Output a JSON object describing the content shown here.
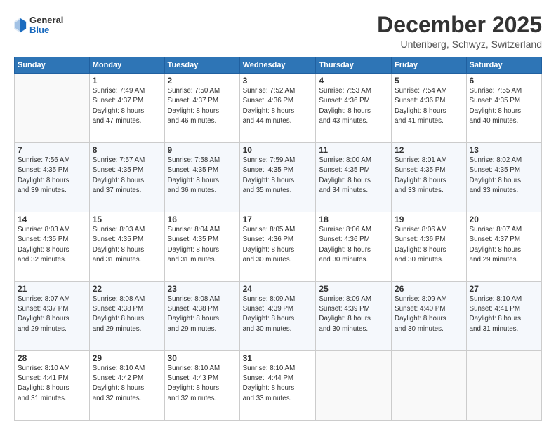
{
  "logo": {
    "general": "General",
    "blue": "Blue"
  },
  "header": {
    "month": "December 2025",
    "location": "Unteriberg, Schwyz, Switzerland"
  },
  "weekdays": [
    "Sunday",
    "Monday",
    "Tuesday",
    "Wednesday",
    "Thursday",
    "Friday",
    "Saturday"
  ],
  "weeks": [
    [
      {
        "day": "",
        "info": ""
      },
      {
        "day": "1",
        "info": "Sunrise: 7:49 AM\nSunset: 4:37 PM\nDaylight: 8 hours\nand 47 minutes."
      },
      {
        "day": "2",
        "info": "Sunrise: 7:50 AM\nSunset: 4:37 PM\nDaylight: 8 hours\nand 46 minutes."
      },
      {
        "day": "3",
        "info": "Sunrise: 7:52 AM\nSunset: 4:36 PM\nDaylight: 8 hours\nand 44 minutes."
      },
      {
        "day": "4",
        "info": "Sunrise: 7:53 AM\nSunset: 4:36 PM\nDaylight: 8 hours\nand 43 minutes."
      },
      {
        "day": "5",
        "info": "Sunrise: 7:54 AM\nSunset: 4:36 PM\nDaylight: 8 hours\nand 41 minutes."
      },
      {
        "day": "6",
        "info": "Sunrise: 7:55 AM\nSunset: 4:35 PM\nDaylight: 8 hours\nand 40 minutes."
      }
    ],
    [
      {
        "day": "7",
        "info": "Sunrise: 7:56 AM\nSunset: 4:35 PM\nDaylight: 8 hours\nand 39 minutes."
      },
      {
        "day": "8",
        "info": "Sunrise: 7:57 AM\nSunset: 4:35 PM\nDaylight: 8 hours\nand 37 minutes."
      },
      {
        "day": "9",
        "info": "Sunrise: 7:58 AM\nSunset: 4:35 PM\nDaylight: 8 hours\nand 36 minutes."
      },
      {
        "day": "10",
        "info": "Sunrise: 7:59 AM\nSunset: 4:35 PM\nDaylight: 8 hours\nand 35 minutes."
      },
      {
        "day": "11",
        "info": "Sunrise: 8:00 AM\nSunset: 4:35 PM\nDaylight: 8 hours\nand 34 minutes."
      },
      {
        "day": "12",
        "info": "Sunrise: 8:01 AM\nSunset: 4:35 PM\nDaylight: 8 hours\nand 33 minutes."
      },
      {
        "day": "13",
        "info": "Sunrise: 8:02 AM\nSunset: 4:35 PM\nDaylight: 8 hours\nand 33 minutes."
      }
    ],
    [
      {
        "day": "14",
        "info": "Sunrise: 8:03 AM\nSunset: 4:35 PM\nDaylight: 8 hours\nand 32 minutes."
      },
      {
        "day": "15",
        "info": "Sunrise: 8:03 AM\nSunset: 4:35 PM\nDaylight: 8 hours\nand 31 minutes."
      },
      {
        "day": "16",
        "info": "Sunrise: 8:04 AM\nSunset: 4:35 PM\nDaylight: 8 hours\nand 31 minutes."
      },
      {
        "day": "17",
        "info": "Sunrise: 8:05 AM\nSunset: 4:36 PM\nDaylight: 8 hours\nand 30 minutes."
      },
      {
        "day": "18",
        "info": "Sunrise: 8:06 AM\nSunset: 4:36 PM\nDaylight: 8 hours\nand 30 minutes."
      },
      {
        "day": "19",
        "info": "Sunrise: 8:06 AM\nSunset: 4:36 PM\nDaylight: 8 hours\nand 30 minutes."
      },
      {
        "day": "20",
        "info": "Sunrise: 8:07 AM\nSunset: 4:37 PM\nDaylight: 8 hours\nand 29 minutes."
      }
    ],
    [
      {
        "day": "21",
        "info": "Sunrise: 8:07 AM\nSunset: 4:37 PM\nDaylight: 8 hours\nand 29 minutes."
      },
      {
        "day": "22",
        "info": "Sunrise: 8:08 AM\nSunset: 4:38 PM\nDaylight: 8 hours\nand 29 minutes."
      },
      {
        "day": "23",
        "info": "Sunrise: 8:08 AM\nSunset: 4:38 PM\nDaylight: 8 hours\nand 29 minutes."
      },
      {
        "day": "24",
        "info": "Sunrise: 8:09 AM\nSunset: 4:39 PM\nDaylight: 8 hours\nand 30 minutes."
      },
      {
        "day": "25",
        "info": "Sunrise: 8:09 AM\nSunset: 4:39 PM\nDaylight: 8 hours\nand 30 minutes."
      },
      {
        "day": "26",
        "info": "Sunrise: 8:09 AM\nSunset: 4:40 PM\nDaylight: 8 hours\nand 30 minutes."
      },
      {
        "day": "27",
        "info": "Sunrise: 8:10 AM\nSunset: 4:41 PM\nDaylight: 8 hours\nand 31 minutes."
      }
    ],
    [
      {
        "day": "28",
        "info": "Sunrise: 8:10 AM\nSunset: 4:41 PM\nDaylight: 8 hours\nand 31 minutes."
      },
      {
        "day": "29",
        "info": "Sunrise: 8:10 AM\nSunset: 4:42 PM\nDaylight: 8 hours\nand 32 minutes."
      },
      {
        "day": "30",
        "info": "Sunrise: 8:10 AM\nSunset: 4:43 PM\nDaylight: 8 hours\nand 32 minutes."
      },
      {
        "day": "31",
        "info": "Sunrise: 8:10 AM\nSunset: 4:44 PM\nDaylight: 8 hours\nand 33 minutes."
      },
      {
        "day": "",
        "info": ""
      },
      {
        "day": "",
        "info": ""
      },
      {
        "day": "",
        "info": ""
      }
    ]
  ]
}
